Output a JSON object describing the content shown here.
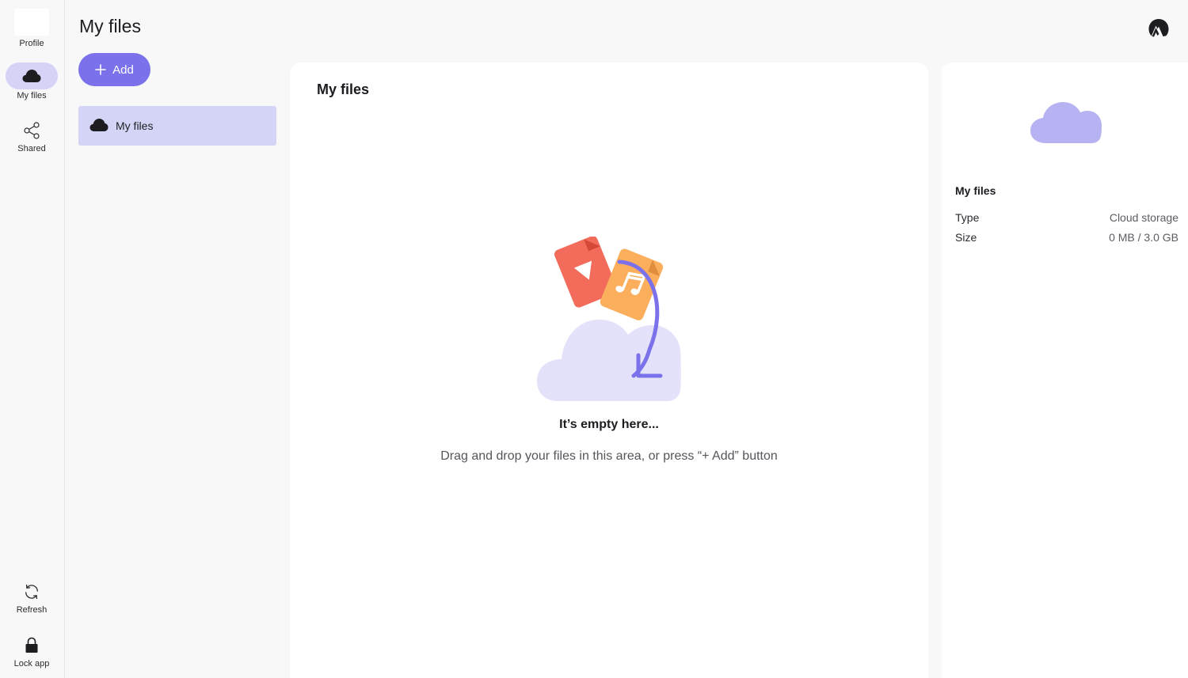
{
  "rail": {
    "profile_label": "Profile",
    "myfiles_label": "My files",
    "shared_label": "Shared",
    "refresh_label": "Refresh",
    "lock_label": "Lock app"
  },
  "header": {
    "title": "My files",
    "add_label": "Add"
  },
  "tree": {
    "items": [
      {
        "label": "My files",
        "selected": true
      }
    ]
  },
  "main": {
    "title": "My files",
    "empty_title": "It’s empty here...",
    "empty_subtitle": "Drag and drop your files in this area, or press “+ Add” button"
  },
  "details": {
    "title": "My files",
    "properties": [
      {
        "key": "Type",
        "value": "Cloud storage"
      },
      {
        "key": "Size",
        "value": "0 MB / 3.0 GB"
      }
    ]
  },
  "colors": {
    "accent": "#7b72eb",
    "selection": "#d4d4f6",
    "cloud_light": "#e3e2fa",
    "cloud_medium": "#b7b3f3",
    "video_red": "#f26b5b",
    "music_orange": "#fbae5c"
  },
  "icons": [
    "cloud-icon",
    "share-icon",
    "refresh-icon",
    "lock-icon",
    "plus-icon",
    "brand-logo-icon"
  ]
}
